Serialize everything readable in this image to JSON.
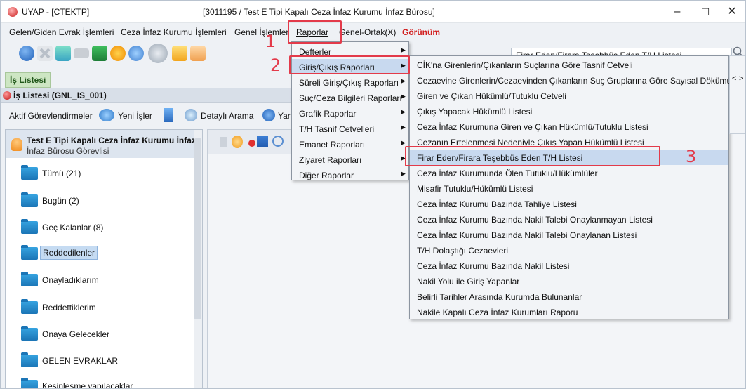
{
  "window": {
    "app_title": "UYAP - [CTEKTP]",
    "doc_title": "[3011195 / Test E Tipi Kapalı Ceza İnfaz Kurumu İnfaz Bürosu]",
    "minimize": "–",
    "maximize": "☐",
    "close": "✕"
  },
  "menubar": {
    "items": [
      "Gelen/Giden Evrak İşlemleri",
      "Ceza İnfaz Kurumu İşlemleri",
      "Genel İşlemler",
      "Raporlar",
      "Genel-Ortak(X)",
      "Görünüm"
    ],
    "search_value": "Firar Eden/Firara Teşebbüs Eden T/H Listesi",
    "search_icon": "magnifier-icon"
  },
  "tabs": {
    "active": "İş Listesi"
  },
  "panel": {
    "title": "İş Listesi (GNL_IS_001)"
  },
  "actions": {
    "gorevlendirme": "Aktif Görevlendirmeler",
    "yeni_isler": "Yeni İşler",
    "detayli_arama": "Detaylı Arama",
    "yar": "Yar"
  },
  "sidebar": {
    "header_title": "Test E Tipi Kapalı Ceza İnfaz Kurumu İnfaz B",
    "header_sub": "İnfaz Bürosu Görevlisi",
    "items": [
      "Tümü (21)",
      "Bugün (2)",
      "Geç Kalanlar (8)",
      "Reddedilenler",
      "Onayladıklarım",
      "Reddettiklerim",
      "Onaya Gelecekler",
      "GELEN EVRAKLAR",
      "Kesinleşme yapılacaklar"
    ]
  },
  "raporlar_menu": {
    "items": [
      "Defterler",
      "Giriş/Çıkış Raporları",
      "Süreli Giriş/Çıkış Raporları",
      "Suç/Ceza Bilgileri Raporları",
      "Grafik Raporlar",
      "T/H Tasnif Cetvelleri",
      "Emanet Raporları",
      "Ziyaret Raporları",
      "Diğer Raporlar"
    ]
  },
  "giris_cikis_submenu": {
    "items": [
      "CİK'na Girenlerin/Çıkanların Suçlarına Göre Tasnif Cetveli",
      "Cezaevine Girenlerin/Cezaevinden Çıkanların Suç Gruplarına Göre Sayısal Dökümü",
      "Giren ve Çıkan Hükümlü/Tutuklu Cetveli",
      "Çıkış Yapacak Hükümlü Listesi",
      "Ceza İnfaz Kurumuna Giren ve Çıkan Hükümlü/Tutuklu Listesi",
      "Cezanın Ertelenmesi Nedeniyle Çıkış Yapan Hükümlü Listesi",
      "Firar Eden/Firara Teşebbüs Eden T/H Listesi",
      "Ceza İnfaz Kurumunda Ölen Tutuklu/Hükümlüler",
      "Misafir Tutuklu/Hükümlü Listesi",
      "Ceza İnfaz Kurumu Bazında Tahliye Listesi",
      "Ceza İnfaz Kurumu Bazında Nakil Talebi Onaylanmayan Listesi",
      "Ceza İnfaz Kurumu Bazında Nakil Talebi Onaylanan Listesi",
      "T/H Dolaştığı Cezaevleri",
      "Ceza İnfaz Kurumu Bazında Nakil Listesi",
      "Nakil Yolu ile Giriş Yapanlar",
      "Belirli Tarihler Arasında Kurumda Bulunanlar",
      "Nakile Kapalı Ceza İnfaz Kurumları Raporu"
    ]
  },
  "callouts": {
    "one": "1",
    "two": "2",
    "three": "3"
  },
  "colors": {
    "callout": "#e33a4a",
    "highlight": "#c8d9ef",
    "red_menu": "#d21f1f"
  }
}
